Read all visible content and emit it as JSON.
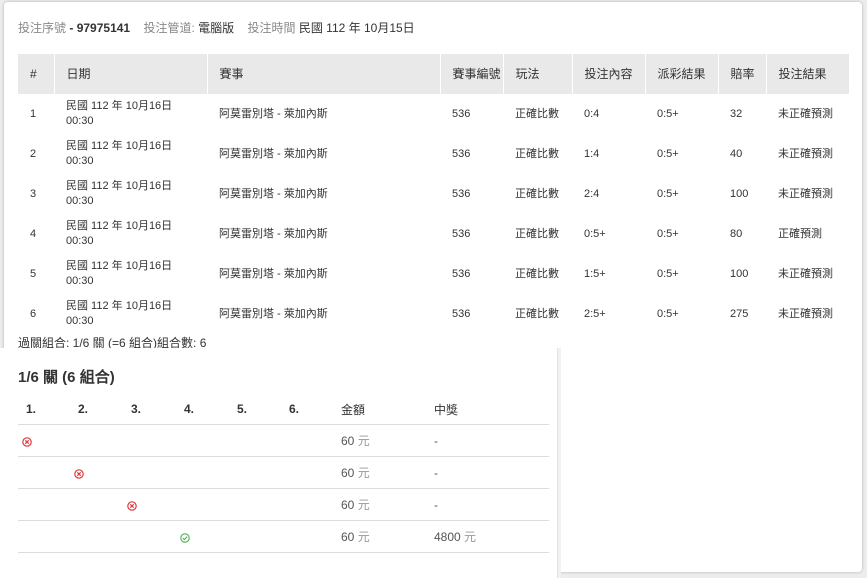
{
  "header": {
    "serial_label": "投注序號",
    "serial_sep": "-",
    "serial_value": "97975141",
    "channel_label": "投注管道:",
    "channel_value": "電腦版",
    "time_label": "投注時間",
    "time_value": "民國 112 年 10月15日"
  },
  "bets_table": {
    "columns": [
      "#",
      "日期",
      "賽事",
      "賽事編號",
      "玩法",
      "投注內容",
      "派彩結果",
      "賠率",
      "投注結果"
    ],
    "rows": [
      {
        "no": "1",
        "date": "民國 112 年 10月16日",
        "time": "00:30",
        "match": "阿莫雷別塔 - 萊加內斯",
        "match_no": "536",
        "play": "正確比數",
        "pick": "0:4",
        "payout": "0:5+",
        "odds": "32",
        "result": "未正確預測"
      },
      {
        "no": "2",
        "date": "民國 112 年 10月16日",
        "time": "00:30",
        "match": "阿莫雷別塔 - 萊加內斯",
        "match_no": "536",
        "play": "正確比數",
        "pick": "1:4",
        "payout": "0:5+",
        "odds": "40",
        "result": "未正確預測"
      },
      {
        "no": "3",
        "date": "民國 112 年 10月16日",
        "time": "00:30",
        "match": "阿莫雷別塔 - 萊加內斯",
        "match_no": "536",
        "play": "正確比數",
        "pick": "2:4",
        "payout": "0:5+",
        "odds": "100",
        "result": "未正確預測"
      },
      {
        "no": "4",
        "date": "民國 112 年 10月16日",
        "time": "00:30",
        "match": "阿莫雷別塔 - 萊加內斯",
        "match_no": "536",
        "play": "正確比數",
        "pick": "0:5+",
        "payout": "0:5+",
        "odds": "80",
        "result": "正確預測"
      },
      {
        "no": "5",
        "date": "民國 112 年 10月16日",
        "time": "00:30",
        "match": "阿莫雷別塔 - 萊加內斯",
        "match_no": "536",
        "play": "正確比數",
        "pick": "1:5+",
        "payout": "0:5+",
        "odds": "100",
        "result": "未正確預測"
      },
      {
        "no": "6",
        "date": "民國 112 年 10月16日",
        "time": "00:30",
        "match": "阿莫雷別塔 - 萊加內斯",
        "match_no": "536",
        "play": "正確比數",
        "pick": "2:5+",
        "payout": "0:5+",
        "odds": "275",
        "result": "未正確預測"
      }
    ]
  },
  "summary": "過關組合: 1/6 關 (=6 組合)組合數: 6",
  "combo": {
    "title": "1/6 關 (6 組合)",
    "columns": [
      "1.",
      "2.",
      "3.",
      "4.",
      "5.",
      "6.",
      "金額",
      "中獎"
    ],
    "rows": [
      {
        "slot": 1,
        "status": "lose",
        "amount": "60",
        "unit": "元",
        "win": "-",
        "win_unit": ""
      },
      {
        "slot": 2,
        "status": "lose",
        "amount": "60",
        "unit": "元",
        "win": "-",
        "win_unit": ""
      },
      {
        "slot": 3,
        "status": "lose",
        "amount": "60",
        "unit": "元",
        "win": "-",
        "win_unit": ""
      },
      {
        "slot": 4,
        "status": "win",
        "amount": "60",
        "unit": "元",
        "win": "4800",
        "win_unit": "元"
      }
    ],
    "icons": {
      "lose": "x-circle-icon",
      "win": "check-circle-icon"
    },
    "colors": {
      "lose": "#e0393e",
      "win": "#4caf50"
    }
  }
}
